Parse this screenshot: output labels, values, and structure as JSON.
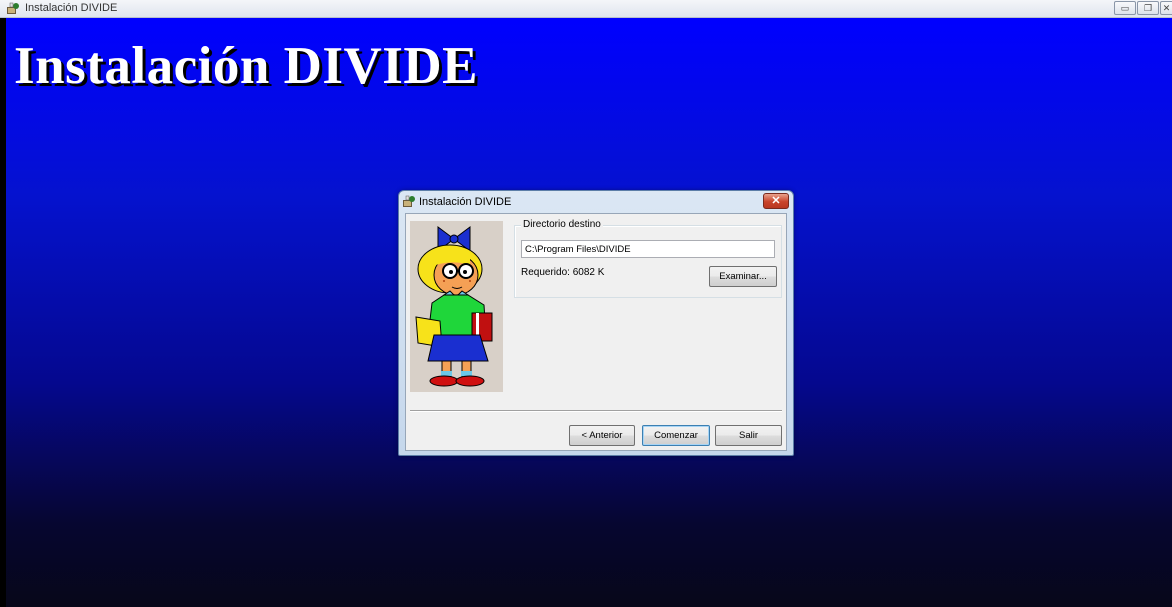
{
  "window": {
    "title": "Instalación DIVIDE",
    "controls": [
      "minimize",
      "restore",
      "close"
    ]
  },
  "main": {
    "heading": "Instalación DIVIDE"
  },
  "dialog": {
    "title": "Instalación DIVIDE",
    "close_symbol": "✕",
    "group_label": "Directorio destino",
    "directory_value": "C:\\Program Files\\DIVIDE",
    "required_text": "Requerido: 6082 K",
    "browse_label": "Examinar...",
    "back_label": "< Anterior",
    "start_label": "Comenzar",
    "exit_label": "Salir"
  },
  "colors": {
    "background_top": "#0000ff",
    "background_bottom": "#070719",
    "heading": "#ffffff",
    "close_button": "#c9432a"
  },
  "icons": {
    "window_icon": "installer-icon",
    "illustration": "girl-with-books-illustration"
  }
}
